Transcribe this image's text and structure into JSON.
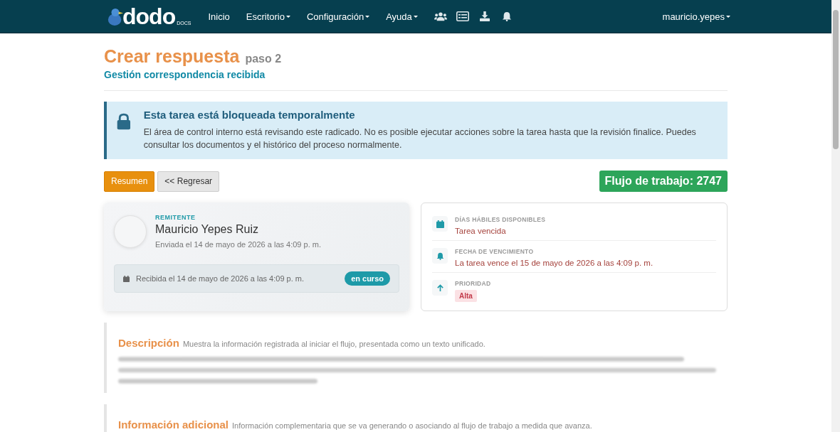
{
  "navbar": {
    "logo_text": "dodo",
    "logo_sub": "DOCS",
    "menu": [
      {
        "label": "Inicio",
        "dropdown": false
      },
      {
        "label": "Escritorio",
        "dropdown": true
      },
      {
        "label": "Configuración",
        "dropdown": true
      },
      {
        "label": "Ayuda",
        "dropdown": true
      }
    ],
    "icons": [
      {
        "kind": "users"
      },
      {
        "kind": "list"
      },
      {
        "kind": "download"
      },
      {
        "kind": "bell"
      }
    ],
    "user": "mauricio.yepes"
  },
  "header": {
    "title": "Crear respuesta",
    "step": "paso 2",
    "subtitle": "Gestión correspondencia recibida"
  },
  "alert": {
    "title": "Esta tarea está bloqueada temporalmente",
    "message": "El área de control interno está revisando este radicado. No es posible ejecutar acciones sobre la tarea hasta que la revisión finalice. Puedes consultar los documentos y el histórico del proceso normalmente."
  },
  "actions": [
    {
      "label": "Resumen",
      "kind": "primary"
    },
    {
      "label": "<< Regresar",
      "kind": "secondary"
    }
  ],
  "workflow_badge": "Flujo de trabajo: 2747",
  "sender": {
    "label": "REMITENTE",
    "name": "Mauricio Yepes Ruiz",
    "sent": "Enviada el 14 de mayo de 2026 a las 4:09 p. m.",
    "received": "Recibida el 14 de mayo de 2026 a las 4:09 p. m.",
    "status": "en curso"
  },
  "details": [
    {
      "kind": "calendar",
      "label": "DÍAS HÁBILES DISPONIBLES",
      "value": "Tarea vencida"
    },
    {
      "kind": "bell",
      "label": "FECHA DE VENCIMIENTO",
      "value": "La tarea vence el 15 de mayo de 2026 a las 4:09 p. m."
    },
    {
      "kind": "priority",
      "label": "PRIORIDAD",
      "tag": "Alta"
    }
  ],
  "sections": [
    {
      "title": "Descripción",
      "hint": "Muestra la información registrada al iniciar el flujo, presentada como un texto unificado.",
      "redacted": true
    },
    {
      "title": "Información adicional",
      "hint": "Información complementaria que se va generando o asociando al flujo de trabajo a medida que avanza.",
      "redacted": false
    }
  ]
}
